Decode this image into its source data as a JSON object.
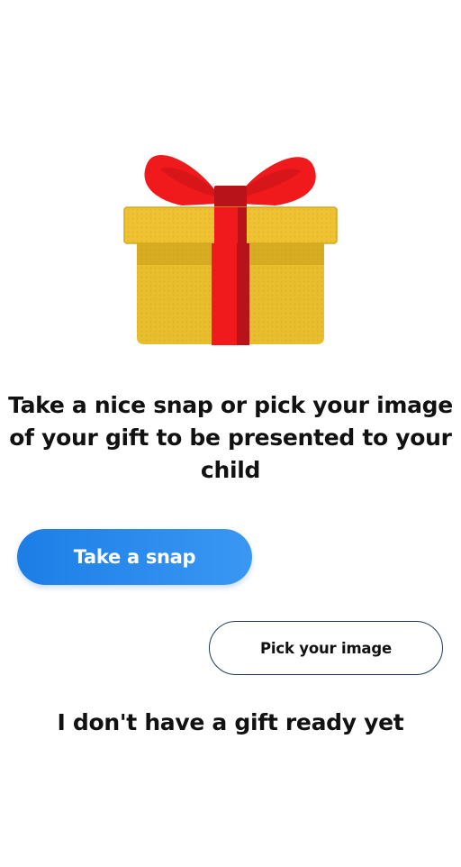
{
  "gift_illustration": {
    "icon": "gift-box-icon",
    "colors": {
      "box": "#e8be2f",
      "box_shade": "#d6a91f",
      "ribbon": "#ee1b1b",
      "ribbon_dark": "#b8131a"
    }
  },
  "instruction_text": "Take a nice snap or pick your image of your gift to be presented to your child",
  "take_snap_button": {
    "label": "Take a snap",
    "color": "#2489ee"
  },
  "pick_image_button": {
    "label": "Pick your image",
    "border_color": "#1f3b5c"
  },
  "no_gift_link": {
    "label": "I don't have a gift ready yet"
  }
}
